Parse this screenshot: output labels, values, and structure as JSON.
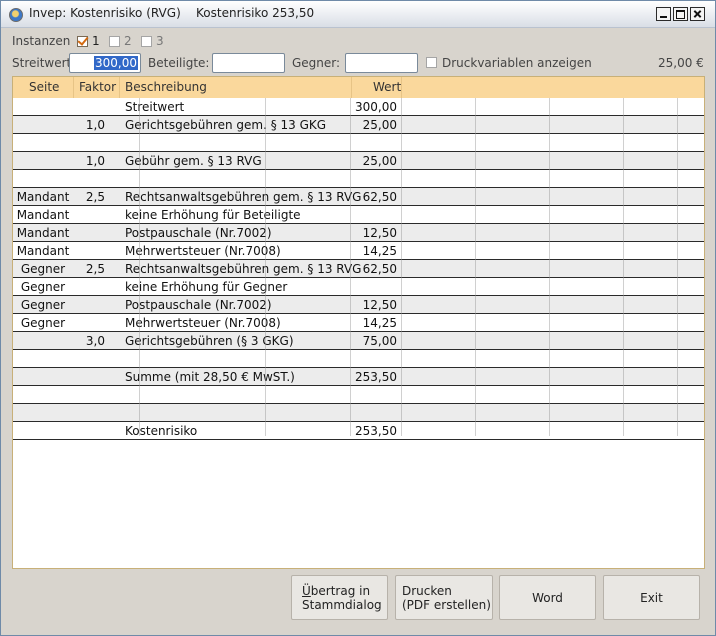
{
  "window": {
    "title": "Invep: Kostenrisiko (RVG)    Kostenrisiko 253,50"
  },
  "instances": {
    "label": "Instanzen",
    "options": [
      {
        "label": "1",
        "checked": true
      },
      {
        "label": "2",
        "checked": false
      },
      {
        "label": "3",
        "checked": false
      }
    ]
  },
  "params": {
    "streitwert_label": "Streitwert",
    "streitwert_value": "300,00",
    "beteiligte_label": "Beteiligte:",
    "beteiligte_value": "",
    "gegner_label": "Gegner:",
    "gegner_value": "",
    "druckvariablen_label": "Druckvariablen anzeigen",
    "druckvariablen_checked": false,
    "amount_display": "25,00 €"
  },
  "table": {
    "headers": {
      "seite": "Seite",
      "faktor": "Faktor",
      "beschreibung": "Beschreibung",
      "wert": "Wert"
    },
    "rows": [
      {
        "seite": "",
        "faktor": "",
        "beschreibung": "Streitwert",
        "wert": "300,00"
      },
      {
        "seite": "",
        "faktor": "1,0",
        "beschreibung": "Gerichtsgebühren gem. § 13 GKG",
        "wert": "25,00"
      },
      {
        "seite": "",
        "faktor": "",
        "beschreibung": "",
        "wert": ""
      },
      {
        "seite": "",
        "faktor": "1,0",
        "beschreibung": "Gebühr gem. § 13 RVG",
        "wert": "25,00"
      },
      {
        "seite": "",
        "faktor": "",
        "beschreibung": "",
        "wert": ""
      },
      {
        "seite": "Mandant",
        "faktor": "2,5",
        "beschreibung": "Rechtsanwaltsgebühren gem. § 13 RVG",
        "wert": "62,50"
      },
      {
        "seite": "Mandant",
        "faktor": "",
        "beschreibung": "keine Erhöhung für Beteiligte",
        "wert": ""
      },
      {
        "seite": "Mandant",
        "faktor": "",
        "beschreibung": "Postpauschale (Nr.7002)",
        "wert": "12,50"
      },
      {
        "seite": "Mandant",
        "faktor": "",
        "beschreibung": "Mehrwertsteuer (Nr.7008)",
        "wert": "14,25"
      },
      {
        "seite": "Gegner",
        "faktor": "2,5",
        "beschreibung": "Rechtsanwaltsgebühren gem. § 13 RVG",
        "wert": "62,50"
      },
      {
        "seite": "Gegner",
        "faktor": "",
        "beschreibung": "keine Erhöhung für Gegner",
        "wert": ""
      },
      {
        "seite": "Gegner",
        "faktor": "",
        "beschreibung": "Postpauschale (Nr.7002)",
        "wert": "12,50"
      },
      {
        "seite": "Gegner",
        "faktor": "",
        "beschreibung": "Mehrwertsteuer (Nr.7008)",
        "wert": "14,25"
      },
      {
        "seite": "",
        "faktor": "3,0",
        "beschreibung": "Gerichtsgebühren (§ 3 GKG)",
        "wert": "75,00"
      },
      {
        "seite": "",
        "faktor": "",
        "beschreibung": "",
        "wert": ""
      },
      {
        "seite": "",
        "faktor": "",
        "beschreibung": "Summe (mit 28,50 € MwST.)",
        "wert": "253,50"
      },
      {
        "seite": "",
        "faktor": "",
        "beschreibung": "",
        "wert": ""
      },
      {
        "seite": "",
        "faktor": "",
        "beschreibung": "",
        "wert": ""
      },
      {
        "seite": "",
        "faktor": "",
        "beschreibung": "Kostenrisiko",
        "wert": "253,50"
      }
    ]
  },
  "buttons": {
    "uebertrag_line1_underlined": "Ü",
    "uebertrag_line1_rest": "bertrag in",
    "uebertrag_line2": "Stammdialog",
    "drucken_line1": "Drucken",
    "drucken_line2": "(PDF erstellen)",
    "word": "Word",
    "exit": "Exit"
  }
}
